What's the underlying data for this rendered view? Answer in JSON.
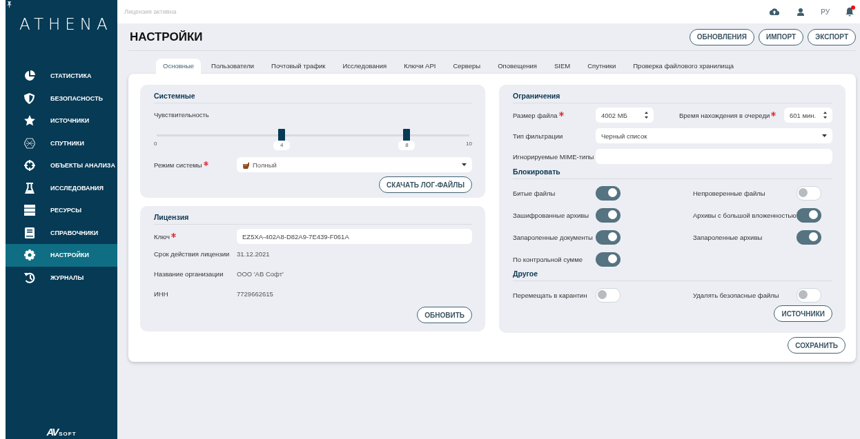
{
  "sidebar": {
    "logo": "ATHENA",
    "items": [
      {
        "label": "СТАТИСТИКА",
        "selected": false
      },
      {
        "label": "БЕЗОПАСНОСТЬ",
        "selected": false
      },
      {
        "label": "ИСТОЧНИКИ",
        "selected": false
      },
      {
        "label": "СПУТНИКИ",
        "selected": false
      },
      {
        "label": "ОБЪЕКТЫ АНАЛИЗА",
        "selected": false
      },
      {
        "label": "ИССЛЕДОВАНИЯ",
        "selected": false
      },
      {
        "label": "РЕСУРСЫ",
        "selected": false
      },
      {
        "label": "СПРАВОЧНИКИ",
        "selected": false
      },
      {
        "label": "НАСТРОЙКИ",
        "selected": true
      },
      {
        "label": "ЖУРНАЛЫ",
        "selected": false
      }
    ],
    "footer_logo": {
      "mark": "AV",
      "suffix": "SOFT"
    }
  },
  "topbar": {
    "status": "Лицензия активна",
    "language": "РУ",
    "notification": {
      "unread": true
    }
  },
  "page": {
    "title": "НАСТРОЙКИ",
    "actions": [
      "ОБНОВЛЕНИЯ",
      "ИМПОРТ",
      "ЭКСПОРТ"
    ]
  },
  "tabs": [
    {
      "label": "Основные",
      "selected": true
    },
    {
      "label": "Пользователи",
      "selected": false
    },
    {
      "label": "Почтовый трафик",
      "selected": false
    },
    {
      "label": "Исследования",
      "selected": false
    },
    {
      "label": "Ключи API",
      "selected": false
    },
    {
      "label": "Серверы",
      "selected": false
    },
    {
      "label": "Оповещения",
      "selected": false
    },
    {
      "label": "SIEM",
      "selected": false
    },
    {
      "label": "Спутники",
      "selected": false
    },
    {
      "label": "Проверка файлового хранилища",
      "selected": false
    }
  ],
  "system": {
    "title": "Системные",
    "sensitivity": {
      "label": "Чувствительность",
      "min": "0",
      "max": "10",
      "thumbs": [
        {
          "level": 0.4,
          "value": "4"
        },
        {
          "level": 0.8,
          "value": "8"
        }
      ]
    },
    "mode": {
      "label": "Режим системы",
      "required": true,
      "value": "Полный"
    },
    "button": "СКАЧАТЬ ЛОГ-ФАЙЛЫ"
  },
  "license": {
    "title": "Лицензия",
    "key": {
      "label": "Ключ",
      "required": true,
      "value": "EZ5XA-402A8-D82A9-7E439-F061A"
    },
    "info": [
      {
        "label": "Срок действия лицензии",
        "value": "31.12.2021"
      },
      {
        "label": "Название организации",
        "value": "ООО 'АВ Софт'"
      },
      {
        "label": "ИНН",
        "value": "7729662615"
      }
    ],
    "button": "ОБНОВИТЬ"
  },
  "limits": {
    "title": "Ограничения",
    "file_size": {
      "label": "Размер файла",
      "required": true,
      "value": "4002 МБ"
    },
    "queue_time": {
      "label": "Время нахождения в очереди",
      "required": true,
      "value": "601 мин."
    },
    "filter_type": {
      "label": "Тип фильтрации",
      "value": "Черный список"
    },
    "ignored_mime": {
      "label": "Игнорируемые MIME-типы"
    }
  },
  "block": {
    "title": "Блокировать",
    "toggles": [
      {
        "label": "Битые файлы",
        "on": true
      },
      {
        "label": "Непроверенные файлы",
        "on": false
      },
      {
        "label": "Зашифрованные архивы",
        "on": true
      },
      {
        "label": "Архивы с большой вложенностью",
        "on": true
      },
      {
        "label": "Запароленные документы",
        "on": true
      },
      {
        "label": "Запароленные архивы",
        "on": true
      },
      {
        "label": "По контрольной сумме",
        "on": true
      }
    ]
  },
  "other": {
    "title": "Другое",
    "toggles": [
      {
        "label": "Перемещать в карантин",
        "on": false
      },
      {
        "label": "Удалять безопасные файлы",
        "on": false
      }
    ],
    "button": "ИСТОЧНИКИ"
  },
  "save_button": "СОХРАНИТЬ"
}
